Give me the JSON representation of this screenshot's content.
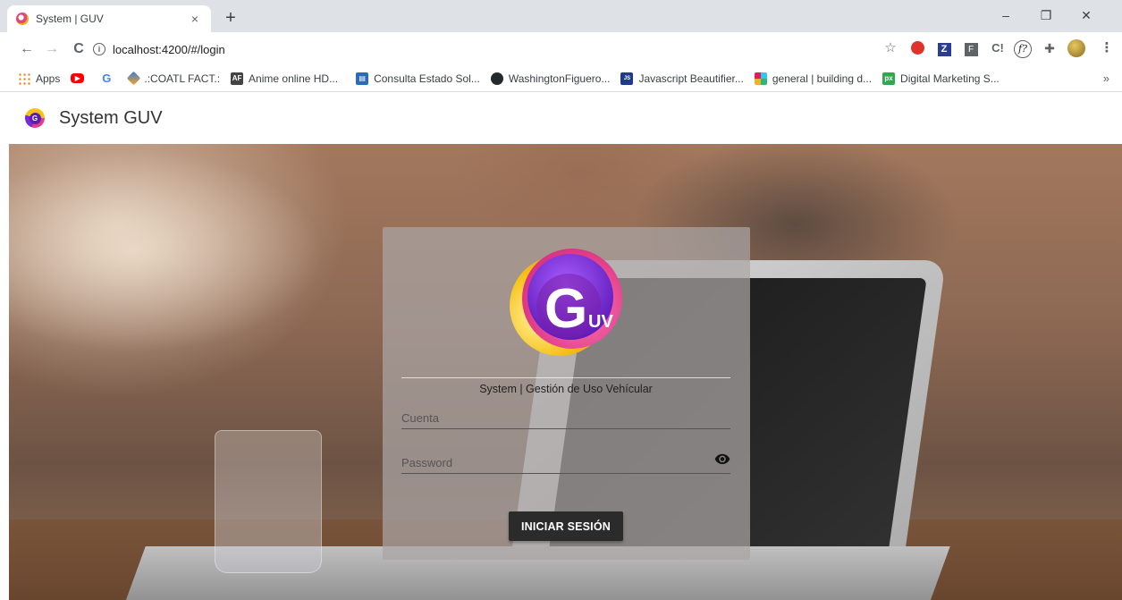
{
  "browser": {
    "tab_title": "System | GUV",
    "tab_close": "×",
    "new_tab": "+",
    "window_controls": {
      "minimize": "–",
      "restore": "❐",
      "close": "✕"
    },
    "nav": {
      "back": "←",
      "forward": "→",
      "reload": "C"
    },
    "url": "localhost:4200/#/login",
    "info_icon": "i",
    "bookmarks": [
      {
        "label": "Apps",
        "icon": "apps-grid-icon",
        "color": "#e37400"
      },
      {
        "label": "",
        "icon": "youtube-icon",
        "color": "#ff0000"
      },
      {
        "label": "",
        "icon": "google-icon",
        "color": "#4285f4"
      },
      {
        "label": ".:COATL FACT.:",
        "icon": "coatl-icon",
        "color": "#3a7bd5"
      },
      {
        "label": "Anime online HD...",
        "icon": "anime-icon",
        "color": "#444444"
      },
      {
        "label": "Consulta Estado Sol...",
        "icon": "consulta-icon",
        "color": "#2a6db5"
      },
      {
        "label": "WashingtonFiguero...",
        "icon": "github-icon",
        "color": "#24292e"
      },
      {
        "label": "Javascript Beautifier...",
        "icon": "beautifier-icon",
        "color": "#1e3a8a"
      },
      {
        "label": "general | building d...",
        "icon": "slack-icon",
        "color": "#611f69"
      },
      {
        "label": "Digital Marketing S...",
        "icon": "px-icon",
        "color": "#2fa84f"
      }
    ],
    "bookmarks_overflow": "»"
  },
  "app": {
    "title": "System GUV",
    "logo_text": "G"
  },
  "login": {
    "logo_letter": "G",
    "logo_sub": "UV",
    "subtitle": "System | Gestión de Uso Vehícular",
    "account_placeholder": "Cuenta",
    "password_placeholder": "Password",
    "submit_label": "INICIAR SESIÓN"
  },
  "colors": {
    "button_bg": "#2b2b2b",
    "card_bg": "rgba(170,165,165,0.72)",
    "logo_purple": "#6a1fc4",
    "logo_pink": "#e63d8a",
    "logo_yellow": "#f7c21b"
  }
}
